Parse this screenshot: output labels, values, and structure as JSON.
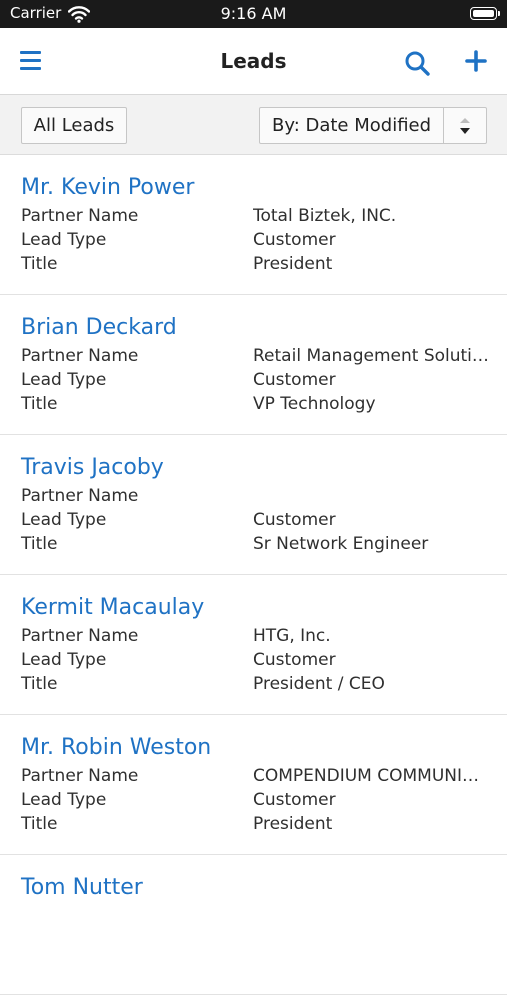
{
  "status_bar": {
    "carrier": "Carrier",
    "time": "9:16 AM"
  },
  "nav": {
    "title": "Leads",
    "icons": [
      "menu-icon",
      "search-icon",
      "add-icon"
    ]
  },
  "filters": {
    "view_button": "All Leads",
    "sort_selected": "By: Date Modified"
  },
  "field_labels": {
    "partner": "Partner Name",
    "type": "Lead Type",
    "title": "Title"
  },
  "leads": [
    {
      "name": "Mr. Kevin Power",
      "partner": "Total Biztek, INC.",
      "type": "Customer",
      "title": "President"
    },
    {
      "name": "Brian Deckard",
      "partner": "Retail Management Solutions",
      "type": "Customer",
      "title": "VP Technology"
    },
    {
      "name": "Travis Jacoby",
      "partner": "",
      "type": "Customer",
      "title": "Sr Network Engineer"
    },
    {
      "name": "Kermit Macaulay",
      "partner": "HTG, Inc.",
      "type": "Customer",
      "title": "President / CEO"
    },
    {
      "name": "Mr. Robin Weston",
      "partner": "COMPENDIUM COMMUNICATIONS",
      "type": "Customer",
      "title": "President"
    },
    {
      "name": "Tom Nutter",
      "partner": "",
      "type": "",
      "title": ""
    }
  ],
  "colors": {
    "accent": "#1f72c4",
    "status_bar": "#1a1a1a",
    "filter_bg": "#f2f2f2"
  }
}
